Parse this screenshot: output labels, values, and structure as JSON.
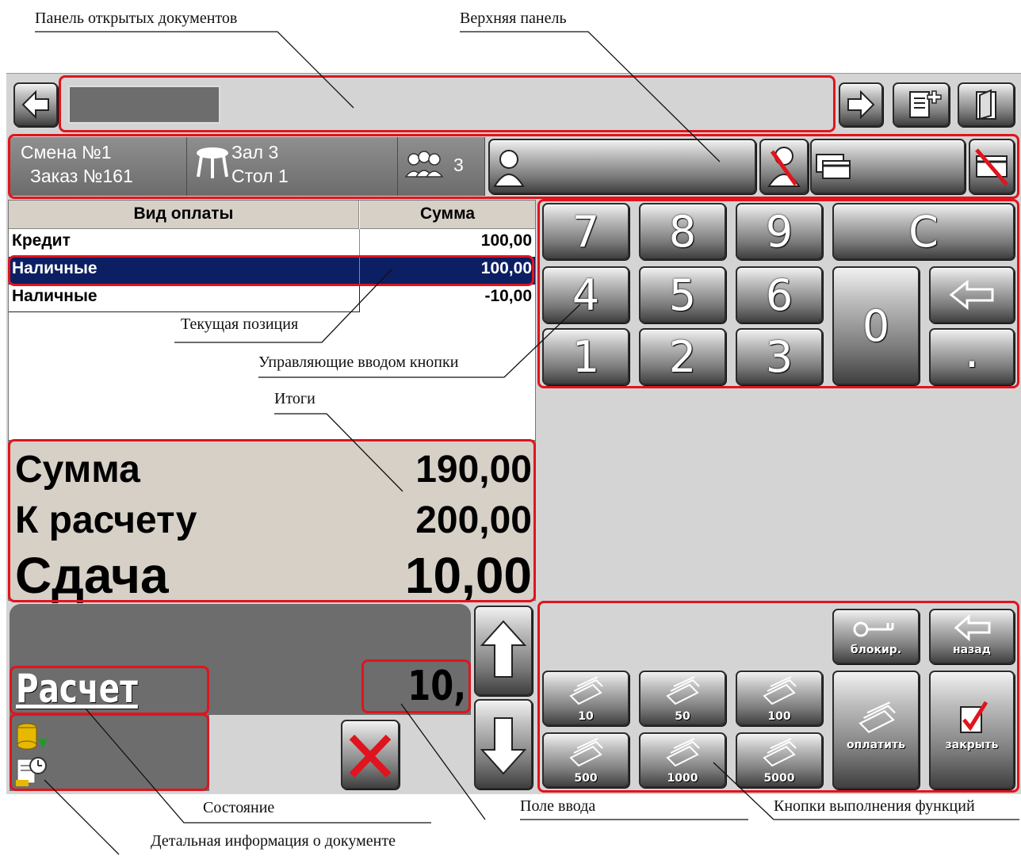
{
  "annotations": {
    "open_docs_panel": "Панель открытых документов",
    "top_panel": "Верхняя панель",
    "current_position": "Текущая позиция",
    "input_control_buttons": "Управляющие вводом кнопки",
    "totals": "Итоги",
    "state": "Состояние",
    "input_field": "Поле ввода",
    "function_buttons": "Кнопки выполнения функций",
    "doc_details": "Детальная информация о документе"
  },
  "info_bar": {
    "shift": "Смена №1",
    "order": "Заказ №161",
    "hall": "Зал 3",
    "table": "Стол 1",
    "guests": "3"
  },
  "payments": {
    "headers": [
      "Вид оплаты",
      "Сумма"
    ],
    "rows": [
      {
        "type": "Кредит",
        "amount": "100,00"
      },
      {
        "type": "Наличные",
        "amount": "100,00"
      },
      {
        "type": "Наличные",
        "amount": "-10,00"
      }
    ]
  },
  "totals": {
    "sum_label": "Сумма",
    "sum_value": "190,00",
    "due_label": "К расчету",
    "due_value": "200,00",
    "change_label": "Сдача",
    "change_value": "10,00"
  },
  "status": {
    "state": "Расчет",
    "input_value": "10,"
  },
  "keypad": {
    "k7": "7",
    "k8": "8",
    "k9": "9",
    "clear": "C",
    "k4": "4",
    "k5": "5",
    "k6": "6",
    "k0": "0",
    "k1": "1",
    "k2": "2",
    "k3": "3",
    "dot": "."
  },
  "functions": {
    "block": "блокир.",
    "back": "назад",
    "pay": "оплатить",
    "close": "закрыть",
    "n10": "10",
    "n50": "50",
    "n100": "100",
    "n500": "500",
    "n1000": "1000",
    "n5000": "5000"
  },
  "colors": {
    "highlight": "#e0141e",
    "selection": "#0c1f63",
    "panel": "#d6d0c7"
  }
}
